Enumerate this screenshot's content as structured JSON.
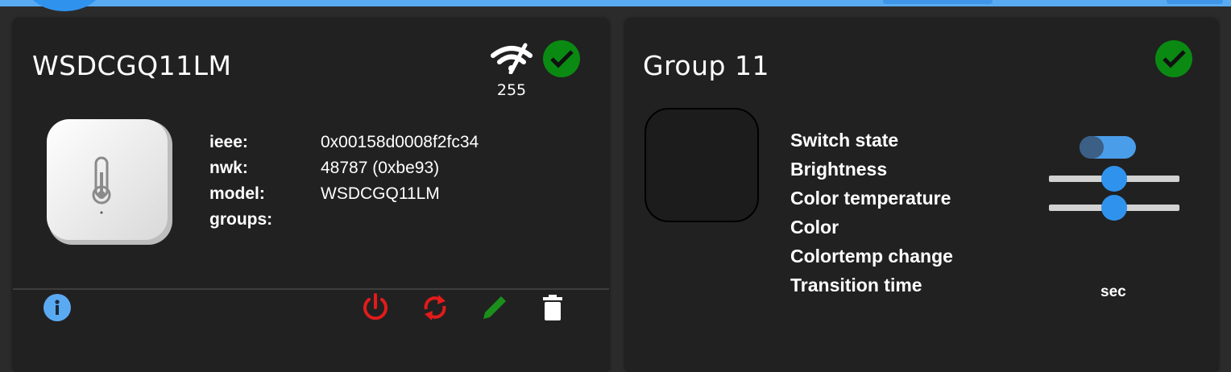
{
  "colors": {
    "accent": "#2f93ee",
    "ok_green": "#0a8a12",
    "danger_red": "#e21b1b",
    "edit_green": "#1b8f1b",
    "card_bg": "#212121"
  },
  "device_card": {
    "title": "WSDCGQ11LM",
    "link_quality": "255",
    "status_icon": "check-circle-icon",
    "signal_icon": "wifi-signal-icon",
    "image_icon": "thermometer-sensor-icon",
    "properties": [
      {
        "key": "ieee:",
        "value": "0x00158d0008f2fc34"
      },
      {
        "key": "nwk:",
        "value": "48787 (0xbe93)"
      },
      {
        "key": "model:",
        "value": "WSDCGQ11LM"
      },
      {
        "key": "groups:",
        "value": ""
      }
    ],
    "actions": [
      "info-icon",
      "power-icon",
      "refresh-icon",
      "pencil-icon",
      "trash-icon"
    ]
  },
  "group_card": {
    "title": "Group 11",
    "status_icon": "check-circle-icon",
    "labels": [
      "Switch state",
      "Brightness",
      "Color temperature",
      "Color",
      "Colortemp change",
      "Transition time"
    ],
    "switch_state_on": false,
    "brightness_level": 0.5,
    "color_temperature_level": 0.5,
    "transition_unit": "sec"
  }
}
